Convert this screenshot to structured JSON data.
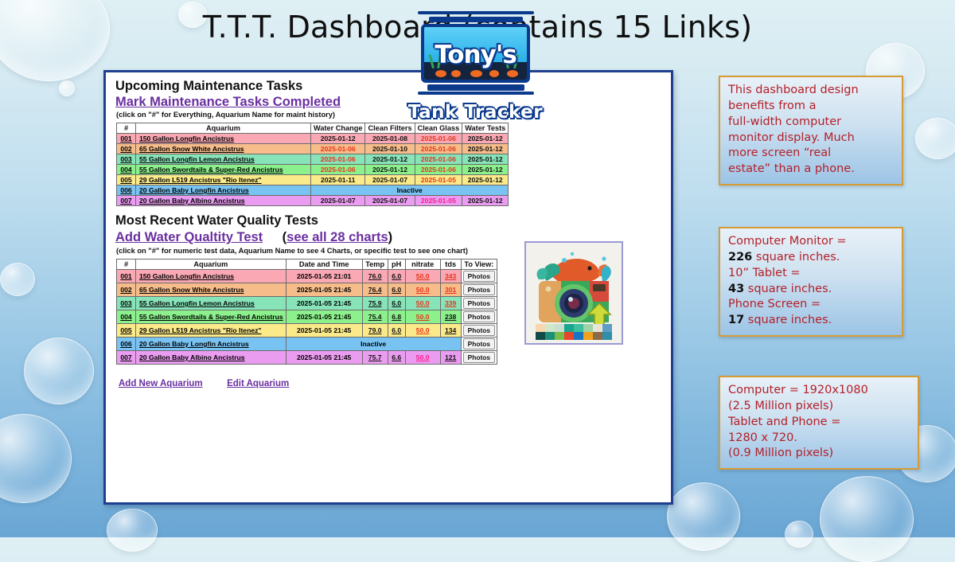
{
  "page": {
    "title": "T.T.T. Dashboard (contains 15 Links)"
  },
  "logo": {
    "brand": "Tony's",
    "subtitle": "Tank Tracker",
    "image_alt": "camera-with-fish-thumbnail"
  },
  "dashboard": {
    "maintenance": {
      "heading": "Upcoming Maintenance Tasks",
      "link": "Mark Maintenance Tasks Completed",
      "hint": "(click on \"#\" for Everything, Aquarium Name for maint history)",
      "columns": [
        "#",
        "Aquarium",
        "Water Change",
        "Clean Filters",
        "Clean Glass",
        "Water Tests"
      ],
      "rows": [
        {
          "num": "001",
          "name": "150 Gallon Longfin Ancistrus",
          "water_change": "2025-01-12",
          "water_change_state": "ok",
          "clean_filters": "2025-01-08",
          "clean_filters_state": "ok",
          "clean_glass": "2025-01-06",
          "clean_glass_state": "bad",
          "water_tests": "2025-01-12",
          "water_tests_state": "ok",
          "inactive": false
        },
        {
          "num": "002",
          "name": "65 Gallon Snow White Ancistrus",
          "water_change": "2025-01-06",
          "water_change_state": "bad",
          "clean_filters": "2025-01-10",
          "clean_filters_state": "ok",
          "clean_glass": "2025-01-06",
          "clean_glass_state": "bad",
          "water_tests": "2025-01-12",
          "water_tests_state": "ok",
          "inactive": false
        },
        {
          "num": "003",
          "name": "55 Gallon Longfin Lemon Ancistrus",
          "water_change": "2025-01-06",
          "water_change_state": "bad",
          "clean_filters": "2025-01-12",
          "clean_filters_state": "ok",
          "clean_glass": "2025-01-06",
          "clean_glass_state": "bad",
          "water_tests": "2025-01-12",
          "water_tests_state": "ok",
          "inactive": false
        },
        {
          "num": "004",
          "name": "55 Gallon Swordtails & Super-Red Ancistrus",
          "water_change": "2025-01-06",
          "water_change_state": "bad",
          "clean_filters": "2025-01-12",
          "clean_filters_state": "ok",
          "clean_glass": "2025-01-06",
          "clean_glass_state": "bad",
          "water_tests": "2025-01-12",
          "water_tests_state": "ok",
          "inactive": false
        },
        {
          "num": "005",
          "name": "29 Gallon L519 Ancistrus \"Rio Itenez\"",
          "water_change": "2025-01-11",
          "water_change_state": "ok",
          "clean_filters": "2025-01-07",
          "clean_filters_state": "ok",
          "clean_glass": "2025-01-05",
          "clean_glass_state": "bad",
          "water_tests": "2025-01-12",
          "water_tests_state": "ok",
          "inactive": false
        },
        {
          "num": "006",
          "name": "20 Gallon Baby Longfin Ancistrus",
          "inactive": true,
          "inactive_label": "Inactive"
        },
        {
          "num": "007",
          "name": "20 Gallon Baby Albino Ancistrus",
          "water_change": "2025-01-07",
          "water_change_state": "ok",
          "clean_filters": "2025-01-07",
          "clean_filters_state": "ok",
          "clean_glass": "2025-01-05",
          "clean_glass_state": "badp",
          "water_tests": "2025-01-12",
          "water_tests_state": "ok",
          "inactive": false
        }
      ]
    },
    "water_quality": {
      "heading": "Most Recent Water Quality Tests",
      "link": "Add Water Qualtity Test",
      "link2_prefix": "(",
      "link2": "see all 28 charts",
      "link2_suffix": ")",
      "hint": "(click on \"#\" for numeric test data, Aquarium Name to see 4 Charts, or specific test to see one chart)",
      "columns": [
        "#",
        "Aquarium",
        "Date and Time",
        "Temp",
        "pH",
        "nitrate",
        "tds",
        "To View:"
      ],
      "view_button": "Photos",
      "rows": [
        {
          "num": "001",
          "name": "150 Gallon Longfin Ancistrus",
          "datetime": "2025-01-05 21:01",
          "temp": "76.0",
          "temp_state": "ok",
          "ph": "6.0",
          "ph_state": "ok",
          "nitrate": "50.0",
          "nitrate_state": "bad",
          "tds": "343",
          "tds_state": "bad",
          "inactive": false
        },
        {
          "num": "002",
          "name": "65 Gallon Snow White Ancistrus",
          "datetime": "2025-01-05 21:45",
          "temp": "76.4",
          "temp_state": "ok",
          "ph": "6.0",
          "ph_state": "ok",
          "nitrate": "50.0",
          "nitrate_state": "bad",
          "tds": "301",
          "tds_state": "bad",
          "inactive": false
        },
        {
          "num": "003",
          "name": "55 Gallon Longfin Lemon Ancistrus",
          "datetime": "2025-01-05 21:45",
          "temp": "75.9",
          "temp_state": "ok",
          "ph": "6.0",
          "ph_state": "ok",
          "nitrate": "50.0",
          "nitrate_state": "bad",
          "tds": "339",
          "tds_state": "bad",
          "inactive": false
        },
        {
          "num": "004",
          "name": "55 Gallon Swordtails & Super-Red Ancistrus",
          "datetime": "2025-01-05 21:45",
          "temp": "75.4",
          "temp_state": "ok",
          "ph": "6.8",
          "ph_state": "ok",
          "nitrate": "50.0",
          "nitrate_state": "bad",
          "tds": "238",
          "tds_state": "ok",
          "inactive": false
        },
        {
          "num": "005",
          "name": "29 Gallon L519 Ancistrus \"Rio Itenez\"",
          "datetime": "2025-01-05 21:45",
          "temp": "79.0",
          "temp_state": "ok",
          "ph": "6.0",
          "ph_state": "ok",
          "nitrate": "50.0",
          "nitrate_state": "bad",
          "tds": "134",
          "tds_state": "ok",
          "inactive": false
        },
        {
          "num": "006",
          "name": "20 Gallon Baby Longfin Ancistrus",
          "inactive": true,
          "inactive_label": "Inactive"
        },
        {
          "num": "007",
          "name": "20 Gallon Baby Albino Ancistrus",
          "datetime": "2025-01-05 21:45",
          "temp": "75.7",
          "temp_state": "ok",
          "ph": "6.6",
          "ph_state": "ok",
          "nitrate": "50.0",
          "nitrate_state": "badp",
          "tds": "121",
          "tds_state": "ok",
          "inactive": false
        }
      ]
    },
    "footer_links": [
      "Add New Aquarium",
      "Edit Aquarium"
    ]
  },
  "notes": [
    {
      "lines": [
        {
          "text": "This dashboard design"
        },
        {
          "text": "benefits from a"
        },
        {
          "text": "full-width computer"
        },
        {
          "text": "monitor display.  Much"
        },
        {
          "text": "more screen “real"
        },
        {
          "text": "estate” than a phone."
        }
      ]
    },
    {
      "lines": [
        {
          "text": "Computer Monitor ="
        },
        {
          "bold": "226",
          "text": " square inches."
        },
        {
          "text": "10” Tablet ="
        },
        {
          "bold": "43",
          "text": " square inches."
        },
        {
          "text": "Phone Screen ="
        },
        {
          "bold": "17",
          "text": " square inches."
        }
      ]
    },
    {
      "lines": [
        {
          "text": "Computer = 1920x1080"
        },
        {
          "text": "(2.5 Million pixels)"
        },
        {
          "text": "Tablet and Phone ="
        },
        {
          "text": "1280 x 720."
        },
        {
          "text": "(0.9 Million pixels)"
        }
      ]
    }
  ],
  "colors": {
    "accent_link": "#6a2fa0",
    "note_text": "#b41f28",
    "note_border": "#d79b34",
    "panel_border": "#1f3f8f",
    "alert": "#e8341c",
    "rows": [
      "#f9a8b4",
      "#f6bd8a",
      "#87e3b8",
      "#8cf08c",
      "#fbea8a",
      "#79c3f2",
      "#ea9df0"
    ]
  }
}
